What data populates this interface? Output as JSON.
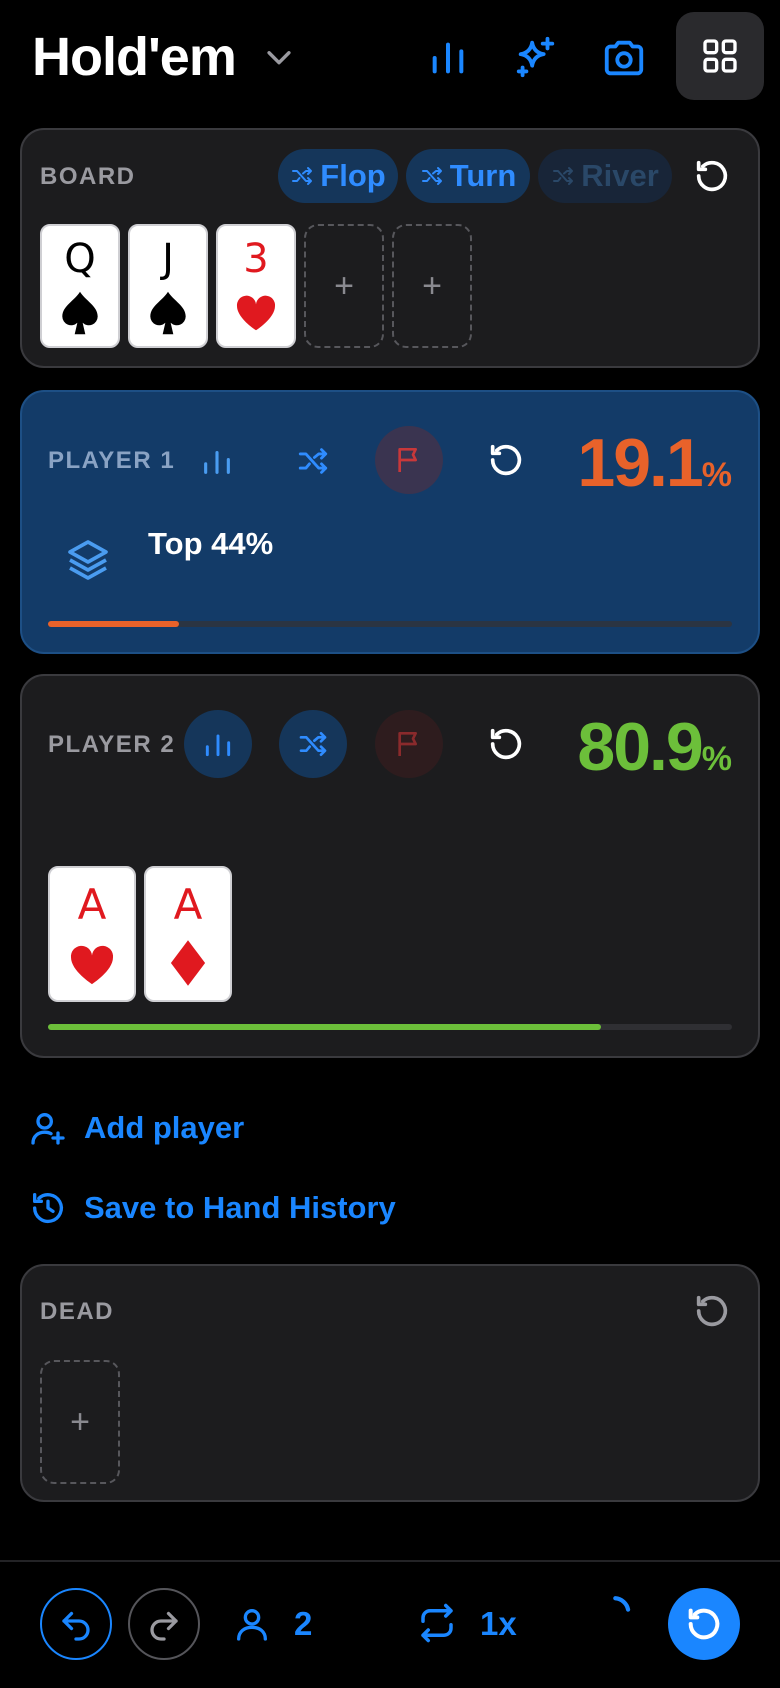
{
  "header": {
    "title": "Hold'em",
    "icons": [
      "chevron-down-icon",
      "bar-chart-icon",
      "sparkle-icon",
      "camera-icon",
      "grid-icon"
    ]
  },
  "board": {
    "label": "BOARD",
    "pills": [
      {
        "label": "Flop",
        "state": "active"
      },
      {
        "label": "Turn",
        "state": "active"
      },
      {
        "label": "River",
        "state": "disabled"
      }
    ],
    "cards": [
      {
        "rank": "Q",
        "suit": "spade"
      },
      {
        "rank": "J",
        "suit": "spade"
      },
      {
        "rank": "3",
        "suit": "heart"
      }
    ],
    "empty_slot_label": "+"
  },
  "player1": {
    "label": "PLAYER 1",
    "equity": "19.1",
    "pct_sign": "%",
    "range_label": "Top 44%",
    "equity_fraction": 0.191,
    "color": "#e8622a"
  },
  "player2": {
    "label": "PLAYER 2",
    "equity": "80.9",
    "pct_sign": "%",
    "cards": [
      {
        "rank": "A",
        "suit": "heart"
      },
      {
        "rank": "A",
        "suit": "diamond"
      }
    ],
    "equity_fraction": 0.809,
    "color": "#6cbf3a"
  },
  "actions": {
    "add_player": "Add player",
    "save_history": "Save to Hand History"
  },
  "dead": {
    "label": "DEAD",
    "empty_slot_label": "+"
  },
  "footer": {
    "players_count": "2",
    "speed": "1x"
  },
  "colors": {
    "accent": "#1a86ff",
    "player1_bg": "#133b68",
    "panel_bg": "#1c1c1e"
  }
}
